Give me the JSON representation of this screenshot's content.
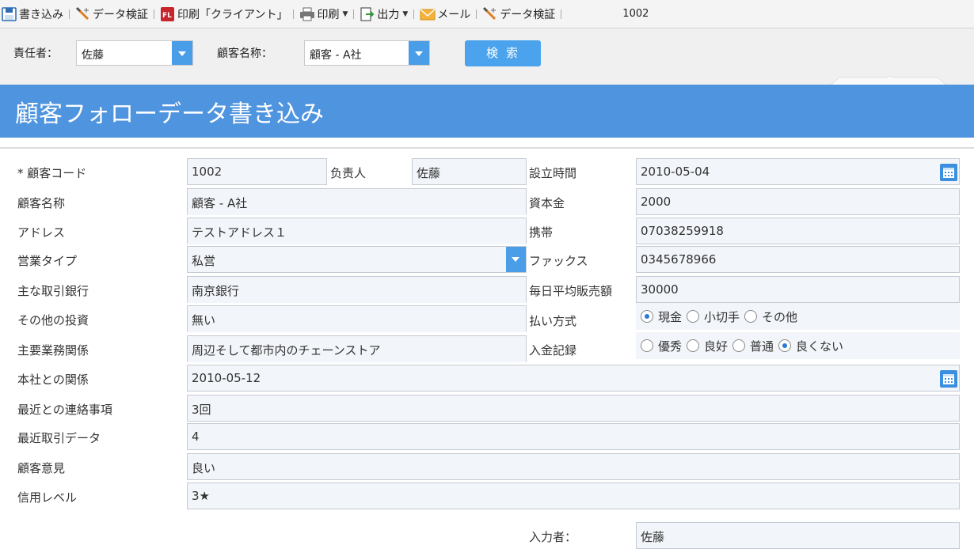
{
  "toolbar": {
    "items": [
      {
        "label": "書き込み",
        "icon": "save-icon"
      },
      {
        "label": "データ検証",
        "icon": "validate-icon"
      },
      {
        "label": "印刷「クライアント」",
        "icon": "pdf-print-icon"
      },
      {
        "label": "印刷",
        "icon": "printer-icon"
      },
      {
        "label": "出力",
        "icon": "export-icon"
      },
      {
        "label": "メール",
        "icon": "mail-icon"
      },
      {
        "label": "データ検証",
        "icon": "validate-icon"
      }
    ],
    "record_number": "1002"
  },
  "search": {
    "manager_label": "責任者：",
    "manager_value": "佐藤",
    "customer_label": "顧客名称：",
    "customer_value": "顧客 - A社",
    "button_label": "検索"
  },
  "banner": {
    "title": "顧客フォローデータ書き込み"
  },
  "form": {
    "customer_code_label": "* 顧客コード",
    "customer_code": "1002",
    "owner_label": "负责人",
    "owner": "佐藤",
    "established_label": "設立時間",
    "established": "2010-05-04",
    "customer_name_label": "顧客名称",
    "customer_name": "顧客 - A社",
    "capital_label": "資本金",
    "capital": "2000",
    "address_label": "アドレス",
    "address": "テストアドレス１",
    "mobile_label": "携帯",
    "mobile": "07038259918",
    "business_type_label": "営業タイプ",
    "business_type": "私営",
    "fax_label": "ファックス",
    "fax": "0345678966",
    "bank_label": "主な取引銀行",
    "bank": "南京銀行",
    "daily_sales_label": "毎日平均販売額",
    "daily_sales": "30000",
    "other_invest_label": "その他の投資",
    "other_invest": "無い",
    "payment_label": "払い方式",
    "payment_options": [
      "現金",
      "小切手",
      "その他"
    ],
    "payment_selected": 0,
    "main_business_label": "主要業務関係",
    "main_business": "周辺そして都市内のチェーンストア",
    "deposit_label": "入金記録",
    "deposit_options": [
      "優秀",
      "良好",
      "普通",
      "良くない"
    ],
    "deposit_selected": 3,
    "hq_relation_label": "本社との関係",
    "hq_relation": "2010-05-12",
    "recent_contact_label": "最近との連絡事項",
    "recent_contact": "3回",
    "recent_trade_label": "最近取引データ",
    "recent_trade": "4",
    "opinion_label": "顧客意見",
    "opinion": "良い",
    "credit_label": "信用レベル",
    "credit": "3★",
    "entered_by_label": "入力者：",
    "entered_by": "佐藤"
  }
}
